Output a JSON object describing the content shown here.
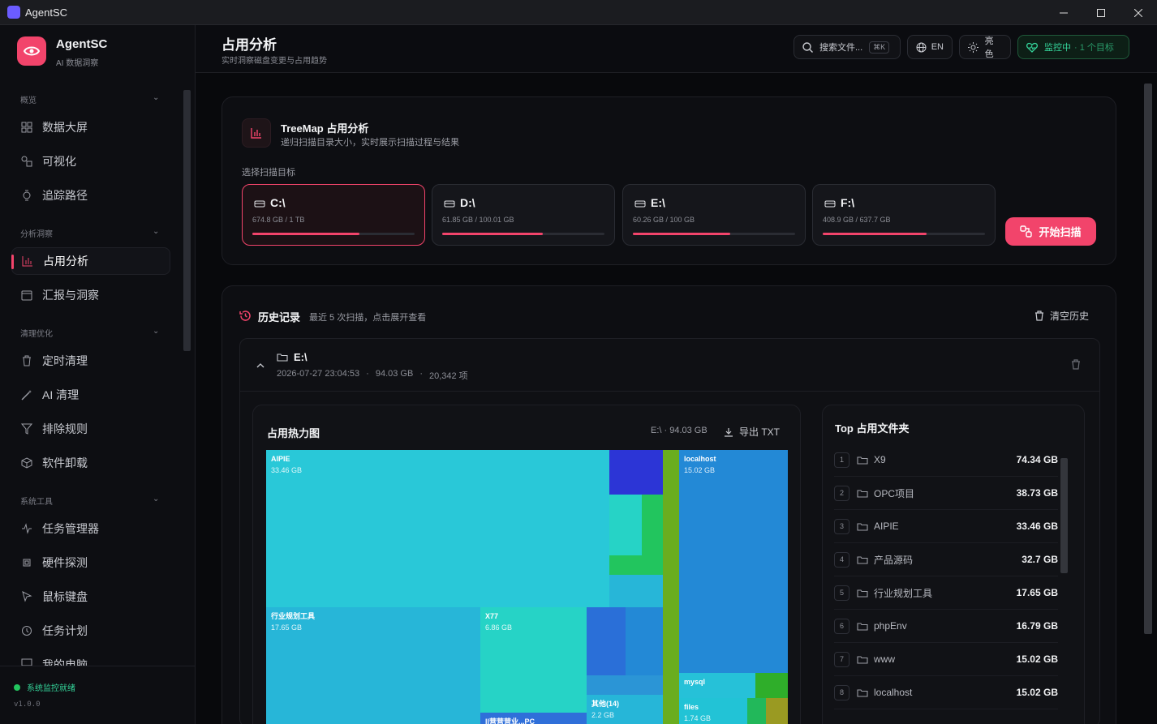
{
  "window": {
    "title": "AgentSC"
  },
  "sidebar": {
    "brand": "AgentSC",
    "brand_sub": "AI 数据洞察",
    "groups": [
      {
        "label": "概览",
        "items": [
          "数据大屏",
          "可视化",
          "追踪路径"
        ]
      },
      {
        "label": "分析洞察",
        "items": [
          "占用分析",
          "汇报与洞察"
        ]
      },
      {
        "label": "清理优化",
        "items": [
          "定时清理",
          "AI 清理",
          "排除规则",
          "软件卸载"
        ]
      },
      {
        "label": "系统工具",
        "items": [
          "任务管理器",
          "硬件探测",
          "鼠标键盘",
          "任务计划",
          "我的电脑"
        ]
      }
    ],
    "active_item": "占用分析",
    "status": "系统监控就绪",
    "version": "v1.0.0"
  },
  "header": {
    "title": "占用分析",
    "subtitle": "实时洞察磁盘变更与占用趋势",
    "search_placeholder": "搜索文件...",
    "search_shortcut": "⌘K",
    "lang": "EN",
    "theme": "亮色",
    "monitor": "监控中",
    "monitor_targets": "· 1 个目标"
  },
  "scan": {
    "title": "TreeMap 占用分析",
    "desc": "递归扫描目录大小，实时展示扫描过程与结果",
    "select_label": "选择扫描目标",
    "drives": [
      {
        "letter": "C:\\",
        "usage": "674.8 GB / 1 TB",
        "fraction": 0.66,
        "selected": true
      },
      {
        "letter": "D:\\",
        "usage": "61.85 GB / 100.01 GB",
        "fraction": 0.62
      },
      {
        "letter": "E:\\",
        "usage": "60.26 GB / 100 GB",
        "fraction": 0.6
      },
      {
        "letter": "F:\\",
        "usage": "408.9 GB / 637.7 GB",
        "fraction": 0.64
      }
    ],
    "start_button": "开始扫描"
  },
  "history": {
    "title": "历史记录",
    "hint": "最近 5 次扫描，点击展开查看",
    "clear": "清空历史",
    "entry": {
      "path": "E:\\",
      "time": "2026-07-27 23:04:53",
      "size": "94.03 GB",
      "items": "20,342 项"
    }
  },
  "heatmap": {
    "title": "占用热力图",
    "summary": "E:\\ · 94.03 GB",
    "export": "导出 TXT",
    "tiles": [
      {
        "name": "AIPIE",
        "size": "33.46 GB",
        "color": "#29c8d8"
      },
      {
        "name": "localhost",
        "size": "15.02 GB",
        "color": "#2389d6"
      },
      {
        "name": "行业规划工具",
        "size": "17.65 GB",
        "color": "#27b6d8"
      },
      {
        "name": "X77",
        "size": "6.86 GB",
        "color": "#26d3c6"
      },
      {
        "name": "mysql",
        "size": "",
        "color": "#26c1d8"
      },
      {
        "name": "其他(14)",
        "size": "2.2 GB",
        "color": "#26b6d8"
      },
      {
        "name": "files",
        "size": "1.74 GB",
        "color": "#22c3d6"
      },
      {
        "name": "ll营营营业...PC",
        "size": "",
        "color": "#2f6fd9"
      }
    ]
  },
  "top": {
    "title": "Top 占用文件夹",
    "rows": [
      {
        "rank": "1",
        "name": "X9",
        "size": "74.34 GB"
      },
      {
        "rank": "2",
        "name": "OPC项目",
        "size": "38.73 GB"
      },
      {
        "rank": "3",
        "name": "AIPIE",
        "size": "33.46 GB"
      },
      {
        "rank": "4",
        "name": "产品源码",
        "size": "32.7 GB"
      },
      {
        "rank": "5",
        "name": "行业规划工具",
        "size": "17.65 GB"
      },
      {
        "rank": "6",
        "name": "phpEnv",
        "size": "16.79 GB"
      },
      {
        "rank": "7",
        "name": "www",
        "size": "15.02 GB"
      },
      {
        "rank": "8",
        "name": "localhost",
        "size": "15.02 GB"
      }
    ]
  },
  "colors": {
    "accent": "#f2446b",
    "ok": "#22c55e"
  }
}
